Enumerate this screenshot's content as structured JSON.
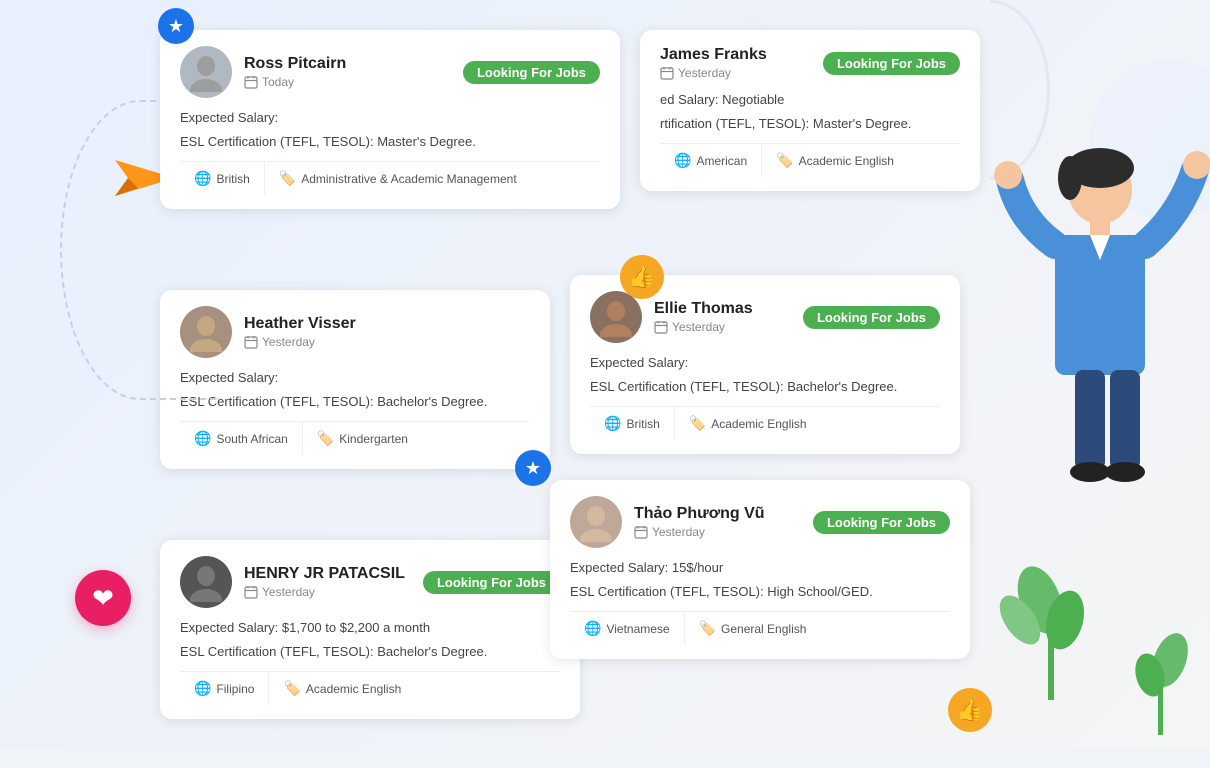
{
  "cards": {
    "ross": {
      "name": "Ross Pitcairn",
      "badge": "Looking For Jobs",
      "date": "Today",
      "salary_label": "Expected Salary:",
      "cert": "ESL Certification (TEFL, TESOL): Master's Degree.",
      "tags": [
        {
          "icon": "globe",
          "label": "British"
        },
        {
          "icon": "tag",
          "label": "Administrative & Academic Management"
        }
      ]
    },
    "james": {
      "name": "James Franks",
      "badge": "Looking For Jobs",
      "date": "Yesterday",
      "salary_label": "ed Salary: Negotiable",
      "cert": "rtification (TEFL, TESOL): Master's Degree.",
      "tags": [
        {
          "icon": "globe",
          "label": "American"
        },
        {
          "icon": "tag",
          "label": "Academic English"
        }
      ]
    },
    "heather": {
      "name": "Heather Visser",
      "badge": null,
      "date": "Yesterday",
      "salary_label": "Expected Salary:",
      "cert": "ESL Certification (TEFL, TESOL): Bachelor's Degree.",
      "tags": [
        {
          "icon": "globe",
          "label": "South African"
        },
        {
          "icon": "tag",
          "label": "Kindergarten"
        }
      ]
    },
    "ellie": {
      "name": "Ellie Thomas",
      "badge": "Looking For Jobs",
      "date": "Yesterday",
      "salary_label": "Expected Salary:",
      "cert": "ESL Certification (TEFL, TESOL): Bachelor's Degree.",
      "tags": [
        {
          "icon": "globe",
          "label": "British"
        },
        {
          "icon": "tag",
          "label": "Academic English"
        }
      ]
    },
    "thao": {
      "name": "Thảo Phương Vũ",
      "badge": "Looking For Jobs",
      "date": "Yesterday",
      "salary_label": "Expected Salary: 15$/hour",
      "cert": "ESL Certification (TEFL, TESOL): High School/GED.",
      "tags": [
        {
          "icon": "globe",
          "label": "Vietnamese"
        },
        {
          "icon": "tag",
          "label": "General English"
        }
      ]
    },
    "henry": {
      "name": "HENRY JR PATACSIL",
      "badge": "Looking For Jobs",
      "date": "Yesterday",
      "salary_label": "Expected Salary: $1,700 to $2,200 a month",
      "cert": "ESL Certification (TEFL, TESOL): Bachelor's Degree.",
      "tags": [
        {
          "icon": "globe",
          "label": "Filipino"
        },
        {
          "icon": "tag",
          "label": "Academic English"
        }
      ]
    }
  }
}
